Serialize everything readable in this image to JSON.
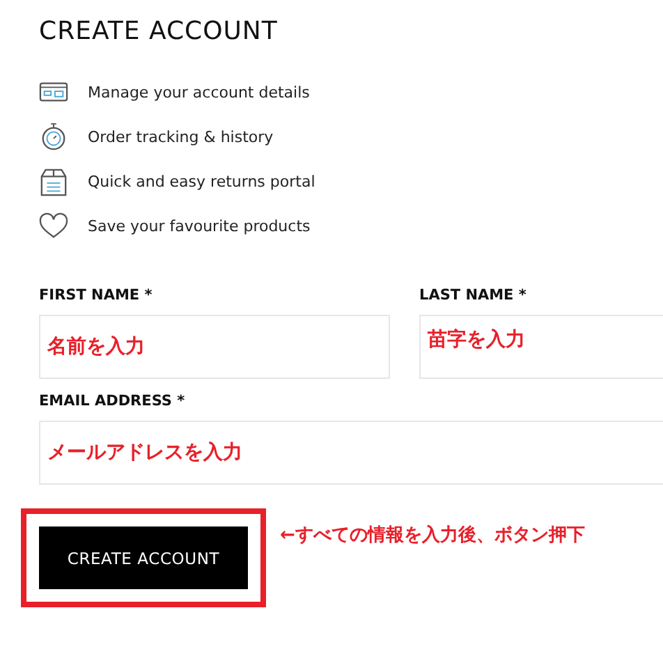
{
  "title": "CREATE ACCOUNT",
  "benefits": [
    {
      "kind": "card",
      "label": "Manage your account details"
    },
    {
      "kind": "timer",
      "label": "Order tracking & history"
    },
    {
      "kind": "box",
      "label": "Quick and easy returns portal"
    },
    {
      "kind": "heart",
      "label": "Save your favourite products"
    }
  ],
  "fields": [
    {
      "label": "FIRST NAME *",
      "annotation": "名前を入力"
    },
    {
      "label": "LAST NAME *",
      "annotation": "苗字を入力"
    },
    {
      "label": "EMAIL ADDRESS *",
      "annotation": "メールアドレスを入力"
    }
  ],
  "submit_button": {
    "label": "CREATE ACCOUNT",
    "highlighted": true
  },
  "annotation": "←すべての情報を入力後、ボタン押下"
}
